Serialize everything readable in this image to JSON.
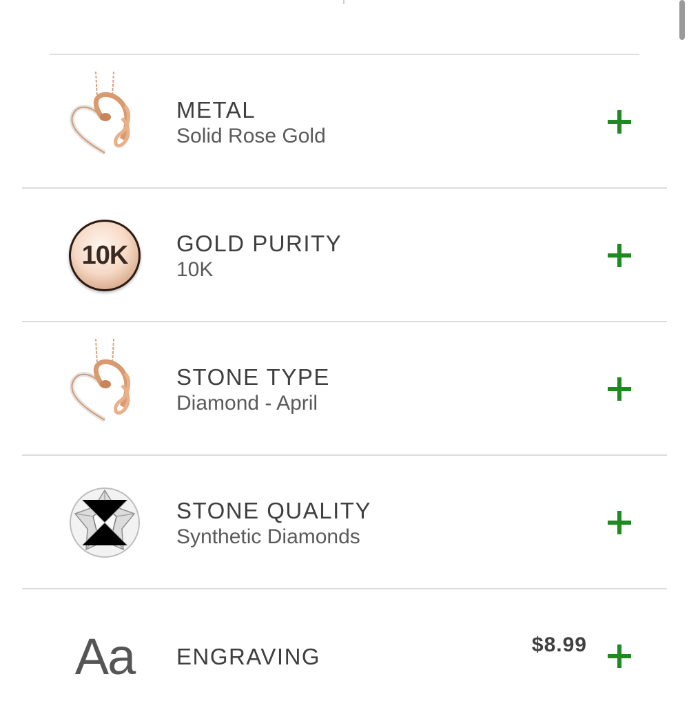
{
  "options": [
    {
      "title": "METAL",
      "value": "Solid Rose Gold",
      "icon": "heart-pendant-icon"
    },
    {
      "title": "GOLD PURITY",
      "value": "10K",
      "icon": "gold-coin-icon",
      "coin_label": "10K"
    },
    {
      "title": "STONE TYPE",
      "value": "Diamond - April",
      "icon": "heart-pendant-icon"
    },
    {
      "title": "STONE QUALITY",
      "value": "Synthetic Diamonds",
      "icon": "diamond-icon"
    },
    {
      "title": "ENGRAVING",
      "value": "",
      "price": "$8.99",
      "icon": "text-aa-icon",
      "icon_text": "Aa"
    }
  ],
  "colors": {
    "accent": "#1f8a1f",
    "text": "#3f3f3f"
  }
}
